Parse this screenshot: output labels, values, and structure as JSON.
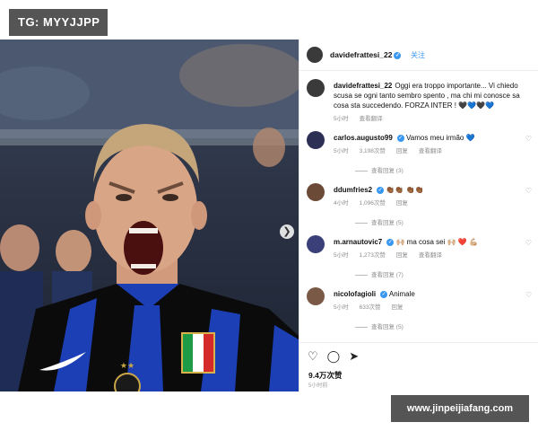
{
  "tg_banner": "TG: MYYJJPP",
  "site_banner": "www.jinpeijiafang.com",
  "header": {
    "username": "davidefrattesi_22",
    "follow_label": "关注"
  },
  "caption": {
    "username": "davidefrattesi_22",
    "text": "Oggi era troppo importante... Vi chiedo scusa se ogni tanto sembro spento , ma chi mi conosce sa cosa sta succedendo. FORZA INTER ! 🖤💙🖤💙",
    "time": "5小时",
    "translate": "查看翻译"
  },
  "comments": [
    {
      "username": "carlos.augusto99",
      "text": "Vamos meu irmão 💙",
      "time": "5小时",
      "likes": "3,198次赞",
      "reply": "回复",
      "translate": "查看翻译",
      "replies": "查看回复 (3)"
    },
    {
      "username": "ddumfries2",
      "text": "👏🏾👏🏾 👏🏾👏🏾",
      "time": "4小时",
      "likes": "1,096次赞",
      "reply": "回复",
      "translate": "",
      "replies": "查看回复 (5)"
    },
    {
      "username": "m.arnautovic7",
      "text": "🙌🏼 ma cosa sei 🙌🏼 ❤️ 💪🏼",
      "time": "5小时",
      "likes": "1,273次赞",
      "reply": "回复",
      "translate": "查看翻译",
      "replies": "查看回复 (7)"
    },
    {
      "username": "nicolofagioli",
      "text": "Animale",
      "time": "5小时",
      "likes": "633次赞",
      "reply": "回复",
      "translate": "",
      "replies": "查看回复 (5)"
    }
  ],
  "actions": {
    "likes": "9.4万次赞",
    "time": "5小时前"
  },
  "icons": {
    "like": "heart-icon",
    "comment": "comment-icon",
    "share": "share-icon",
    "next": "chevron-right-icon",
    "verified": "verified-badge-icon"
  },
  "colors": {
    "link": "#3897f0",
    "inter_blue": "#1c3fb5",
    "inter_black": "#0b0b0b"
  }
}
